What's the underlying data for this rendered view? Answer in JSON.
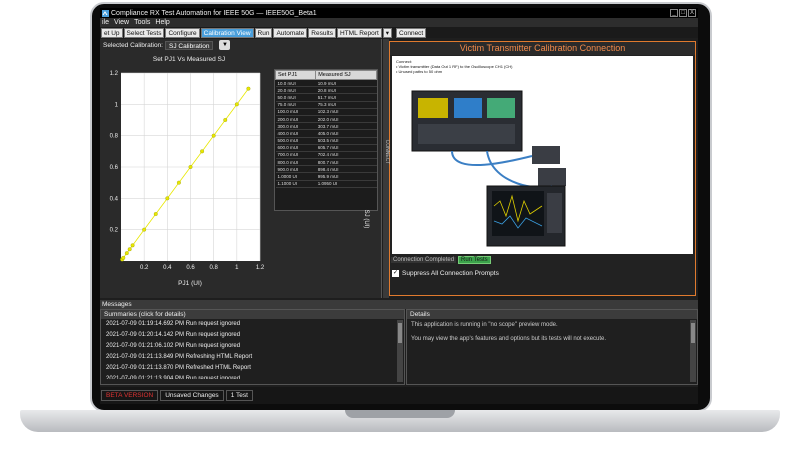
{
  "window": {
    "title": "Compliance RX Test Automation for IEEE 50G — IEEE50G_Beta1",
    "controls": [
      "_",
      "□",
      "X"
    ]
  },
  "menu": [
    "ile",
    "View",
    "Tools",
    "Help"
  ],
  "tabs": [
    {
      "label": "et Up",
      "active": false
    },
    {
      "label": "Select Tests",
      "active": false
    },
    {
      "label": "Configure",
      "active": false
    },
    {
      "label": "Calibration View",
      "active": true
    },
    {
      "label": "Run",
      "active": false
    },
    {
      "label": "Automate",
      "active": false
    },
    {
      "label": "Results",
      "active": false
    },
    {
      "label": "HTML Report",
      "active": false
    },
    {
      "label": "▾",
      "active": false
    }
  ],
  "connect_tab": "Connect",
  "calibration": {
    "label": "Selected Calibration:",
    "value": "SJ Calibration"
  },
  "chart_data": {
    "type": "scatter",
    "title": "Set PJ1 Vs Measured SJ",
    "xlabel": "PJ1 (UI)",
    "ylabel": "SJ (UI)",
    "xlim": [
      0,
      1.2
    ],
    "ylim": [
      0,
      1.2
    ],
    "xticks": [
      "0.2",
      "0.4",
      "0.6",
      "0.8",
      "1",
      "1.2"
    ],
    "yticks": [
      "0.2",
      "0.4",
      "0.6",
      "0.8",
      "1",
      "1.2"
    ],
    "x": [
      0.01,
      0.02,
      0.05,
      0.075,
      0.1,
      0.2,
      0.3,
      0.4,
      0.5,
      0.6,
      0.7,
      0.8,
      0.9,
      1.0,
      1.1
    ],
    "y": [
      0.01,
      0.02,
      0.05,
      0.075,
      0.1,
      0.2,
      0.3,
      0.4,
      0.5,
      0.6,
      0.7,
      0.8,
      0.9,
      1.0,
      1.1
    ],
    "grid": true,
    "marker_color": "#e8e800"
  },
  "table": {
    "headers": [
      "Set PJ1",
      "Measured SJ"
    ],
    "rows": [
      [
        "10.0 mUI",
        "10.9 mUI"
      ],
      [
        "20.0 mUI",
        "20.8 mUI"
      ],
      [
        "50.0 mUI",
        "51.7 mUI"
      ],
      [
        "75.0 mUI",
        "75.3 mUI"
      ],
      [
        "100.0 mUI",
        "102.3 mUI"
      ],
      [
        "200.0 mUI",
        "202.0 mUI"
      ],
      [
        "300.0 mUI",
        "303.7 mUI"
      ],
      [
        "400.0 mUI",
        "405.0 mUI"
      ],
      [
        "500.0 mUI",
        "503.5 mUI"
      ],
      [
        "600.0 mUI",
        "605.7 mUI"
      ],
      [
        "700.0 mUI",
        "702.4 mUI"
      ],
      [
        "800.0 mUI",
        "800.7 mUI"
      ],
      [
        "900.0 mUI",
        "898.4 mUI"
      ],
      [
        "1.0000 UI",
        "995.9 mUI"
      ],
      [
        "1.1000 UI",
        "1.0950 UI"
      ]
    ]
  },
  "connection": {
    "title": "Victim Transmitter Calibration Connection",
    "para_lines": [
      "Connect:",
      "• Victim transmitter (Data Out 1 RF) to the Oscilloscope CH1 (CH)",
      "• Unused paths to 50 ohm"
    ],
    "completed_label": "Connection Completed",
    "run_tests_label": "Run Tests",
    "suppress_label": "Suppress All Connection Prompts",
    "suppress_checked": true,
    "side_label": "CONNECT"
  },
  "messages": {
    "bar_label": "Messages",
    "summaries_header": "Summaries (click for details)",
    "summaries": [
      "2021-07-09 01:19:14.692 PM Run request ignored",
      "2021-07-09 01:20:14.142 PM Run request ignored",
      "2021-07-09 01:21:06.102 PM Run request ignored",
      "2021-07-09 01:21:13.849 PM Refreshing HTML Report",
      "2021-07-09 01:21:13.870 PM Refreshed HTML Report",
      "2021-07-09 01:21:13.904 PM Run request ignored"
    ],
    "details_header": "Details",
    "details": [
      "This application is running in \"no scope\" preview mode.",
      "You may view the app's features and options but its tests will not execute."
    ]
  },
  "status": {
    "beta": "BETA VERSION",
    "unsaved": "Unsaved Changes",
    "tests": "1 Test"
  }
}
